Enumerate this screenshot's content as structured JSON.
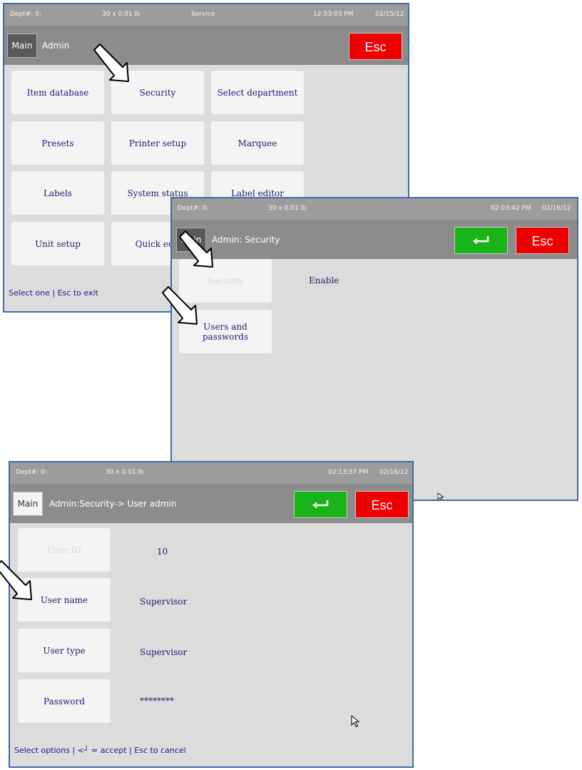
{
  "screen1": {
    "status": {
      "dept": "Dept#: 0:",
      "scale": "30 x 0.01 lb",
      "mode": "Service",
      "time": "12:53:03 PM",
      "date": "02/15/12"
    },
    "main_label": "Main",
    "breadcrumb": "Admin",
    "esc_label": "Esc",
    "tiles": [
      "Item database",
      "Security",
      "Select department",
      "Presets",
      "Printer setup",
      "Marquee",
      "Labels",
      "System status",
      "Label editor",
      "Unit setup",
      "Quick edit"
    ],
    "footer": "Select one | Esc to exit"
  },
  "screen2": {
    "status": {
      "dept": "Dept#: 0:",
      "scale": "30 x 0.01 lb",
      "time": "02:03:42 PM",
      "date": "02/16/12"
    },
    "main_label": "Main",
    "breadcrumb": "Admin: Security",
    "esc_label": "Esc",
    "enter_icon": "enter-icon",
    "rows": [
      {
        "label": "Security",
        "value": "Enable"
      },
      {
        "label": "Users and passwords",
        "value": ""
      }
    ]
  },
  "screen3": {
    "status": {
      "dept": "Dept#: 0:",
      "scale": "30 x 0.01 lb",
      "time": "02:13:57 PM",
      "date": "02/16/12"
    },
    "main_label": "Main",
    "breadcrumb": "Admin:Security-> User admin",
    "esc_label": "Esc",
    "enter_icon": "enter-icon",
    "rows": [
      {
        "label": "User ID",
        "value": "10"
      },
      {
        "label": "User name",
        "value": "Supervisor"
      },
      {
        "label": "User type",
        "value": "Supervisor"
      },
      {
        "label": "Password",
        "value": "********"
      }
    ],
    "footer": "Select options | <┘ = accept | Esc to cancel"
  },
  "colors": {
    "esc": "#ee0000",
    "enter": "#18b418",
    "window_border": "#3b6ea8",
    "text": "#1c1c6e"
  }
}
